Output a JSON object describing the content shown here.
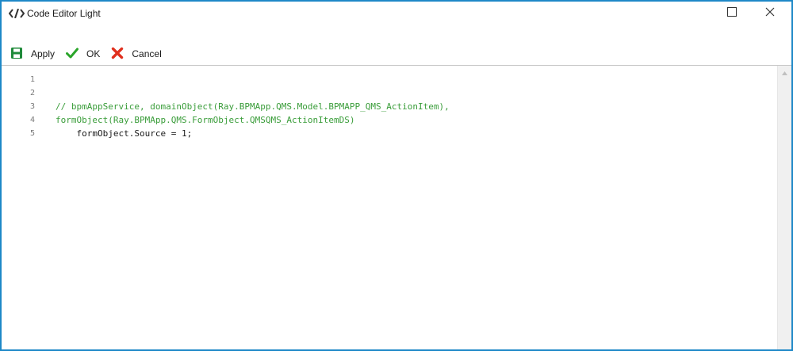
{
  "window": {
    "title": "Code Editor Light",
    "icons": {
      "title": "code-icon",
      "maximize": "maximize-icon",
      "close": "close-icon"
    }
  },
  "toolbar": {
    "apply_label": "Apply",
    "ok_label": "OK",
    "cancel_label": "Cancel",
    "icons": {
      "apply": "save-icon",
      "ok": "checkmark-icon",
      "cancel": "x-icon"
    }
  },
  "colors": {
    "border": "#1e88c7",
    "apply_icon": "#1f8a3a",
    "ok_icon": "#2aa52a",
    "cancel_icon": "#e0301e",
    "comment": "#3a9d3a",
    "code": "#1a1a1a",
    "line_number": "#7a7a7a"
  },
  "editor": {
    "lines": [
      {
        "number": "1",
        "text": "",
        "kind": "normal"
      },
      {
        "number": "2",
        "text": "",
        "kind": "normal"
      },
      {
        "number": "3",
        "text": "// bpmAppService, domainObject(Ray.BPMApp.QMS.Model.BPMAPP_QMS_ActionItem),",
        "kind": "comment"
      },
      {
        "number": "4",
        "text": "formObject(Ray.BPMApp.QMS.FormObject.QMSQMS_ActionItemDS)",
        "kind": "comment"
      },
      {
        "number": "5",
        "text": "    formObject.Source = 1;",
        "kind": "normal"
      }
    ]
  }
}
